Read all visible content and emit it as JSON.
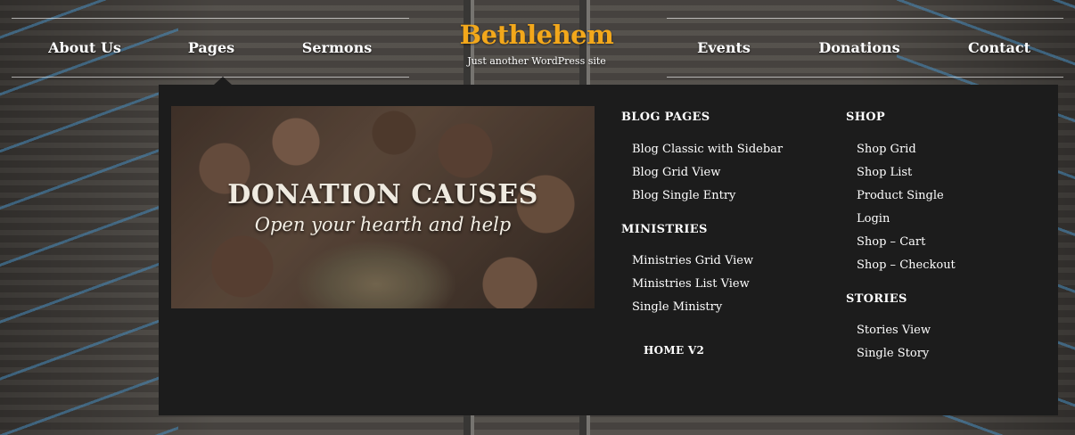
{
  "header": {
    "brand_title": "Bethlehem",
    "brand_tagline": "Just another WordPress site",
    "nav_left": [
      {
        "label": "About Us"
      },
      {
        "label": "Pages"
      },
      {
        "label": "Sermons"
      }
    ],
    "nav_right": [
      {
        "label": "Events"
      },
      {
        "label": "Donations"
      },
      {
        "label": "Contact"
      }
    ]
  },
  "mega_menu": {
    "promo": {
      "title": "DONATION CAUSES",
      "subtitle": "Open your hearth and help"
    },
    "blog_pages": {
      "heading": "BLOG PAGES",
      "items": [
        "Blog Classic with Sidebar",
        "Blog Grid View",
        "Blog Single Entry"
      ]
    },
    "ministries": {
      "heading": "MINISTRIES",
      "items": [
        "Ministries Grid View",
        "Ministries List View",
        "Single Ministry"
      ]
    },
    "home_v2": {
      "label": "HOME V2"
    },
    "shop": {
      "heading": "SHOP",
      "items": [
        "Shop Grid",
        "Shop List",
        "Product Single",
        "Login",
        "Shop – Cart",
        "Shop – Checkout"
      ]
    },
    "stories": {
      "heading": "STORIES",
      "items": [
        "Stories View",
        "Single Story"
      ]
    }
  },
  "colors": {
    "brand": "#f3a81b",
    "menu_bg": "#1c1c1c",
    "text": "#ffffff"
  }
}
